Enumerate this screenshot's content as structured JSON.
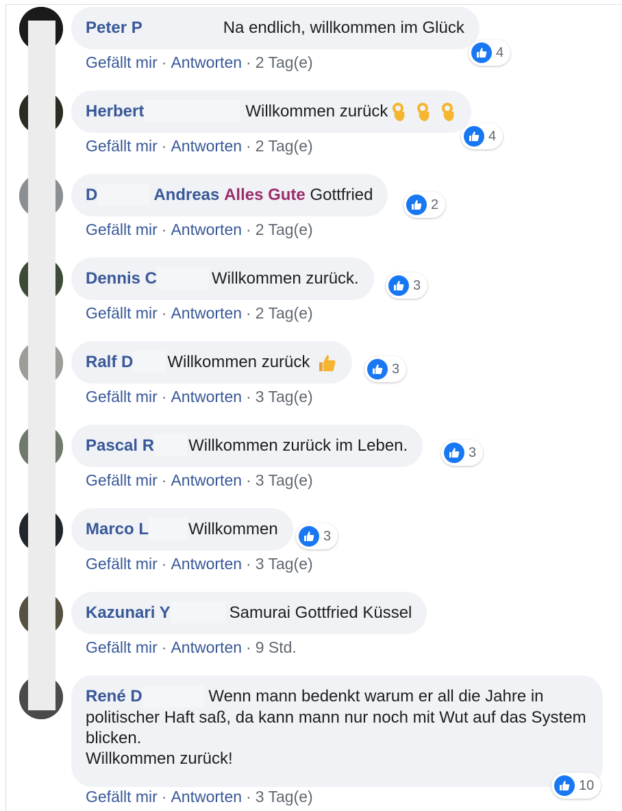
{
  "actions": {
    "like": "Gefällt mir",
    "reply": "Antworten",
    "dot": "·"
  },
  "colors": {
    "author": "#385898",
    "mention": "#9b2d6c",
    "bubble": "#f0f2f5",
    "like": "#1877f2"
  },
  "comments": [
    {
      "author": "Peter P",
      "text": "Na endlich, willkommen im Glück",
      "likes": "4",
      "time": "2 Tag(e)"
    },
    {
      "author": "Herbert",
      "text": "Willkommen zurück",
      "emoji": "ok-hand-icon ×3",
      "likes": "4",
      "time": "2 Tag(e)"
    },
    {
      "author": "D",
      "mention": "Andreas Alles Gute",
      "text": "Gottfried",
      "likes": "2",
      "time": "2 Tag(e)"
    },
    {
      "author": "Dennis C",
      "text": "Willkommen zurück.",
      "likes": "3",
      "time": "2 Tag(e)"
    },
    {
      "author": "Ralf D",
      "text": "Willkommen zurück",
      "emoji": "thumbs-up-icon",
      "likes": "3",
      "time": "3 Tag(e)"
    },
    {
      "author": "Pascal R",
      "text": "Willkommen zurück im Leben.",
      "likes": "3",
      "time": "3 Tag(e)"
    },
    {
      "author": "Marco L",
      "text": "Willkommen",
      "likes": "3",
      "time": "3 Tag(e)"
    },
    {
      "author": "Kazunari Y",
      "text": "Samurai Gottfried Küssel",
      "time": "9 Std."
    },
    {
      "author": "René D",
      "text": "Wenn mann bedenkt warum er all die Jahre in politischer Haft saß, da kann mann nur noch mit Wut auf das System blicken.",
      "text2": "Willkommen zurück!",
      "likes": "10",
      "time": "3 Tag(e)"
    }
  ]
}
